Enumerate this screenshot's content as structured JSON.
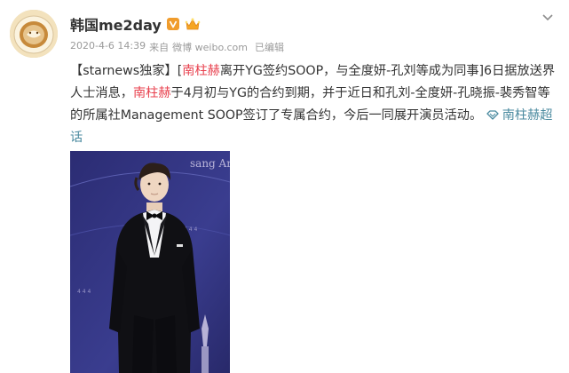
{
  "post": {
    "author": "韩国me2day",
    "timestamp": "2020-4-6 14:39",
    "source_prefix": "来自",
    "source": "微博 weibo.com",
    "edited": "已编辑",
    "content": {
      "tag": "【starnews独家】",
      "bracket_open": "[",
      "name_1": "南柱赫",
      "line1_rest": "离开YG签约SOOP，与全度妍-孔刘等成为同事]6日据放送界人士消息，",
      "name_2": "南柱赫",
      "line2_rest": "于4月初与YG的合约到期，并于近日和孔刘-全度妍-孔晓振-裴秀智等的所属社Management SOOP签订了专属合约，今后一同展开演员活动。",
      "topic": "南柱赫超话"
    },
    "photo_backdrop_text": "sang Art"
  },
  "colors": {
    "highlight": "#e8424f",
    "topic_link": "#4a8a9f",
    "verified_badge": "#f09c2c",
    "meta_text": "#9a9a9a"
  },
  "icons": {
    "verified": "verified-badge-icon",
    "crown": "crown-badge-icon",
    "dropdown": "chevron-down-icon",
    "topic": "super-topic-icon"
  }
}
